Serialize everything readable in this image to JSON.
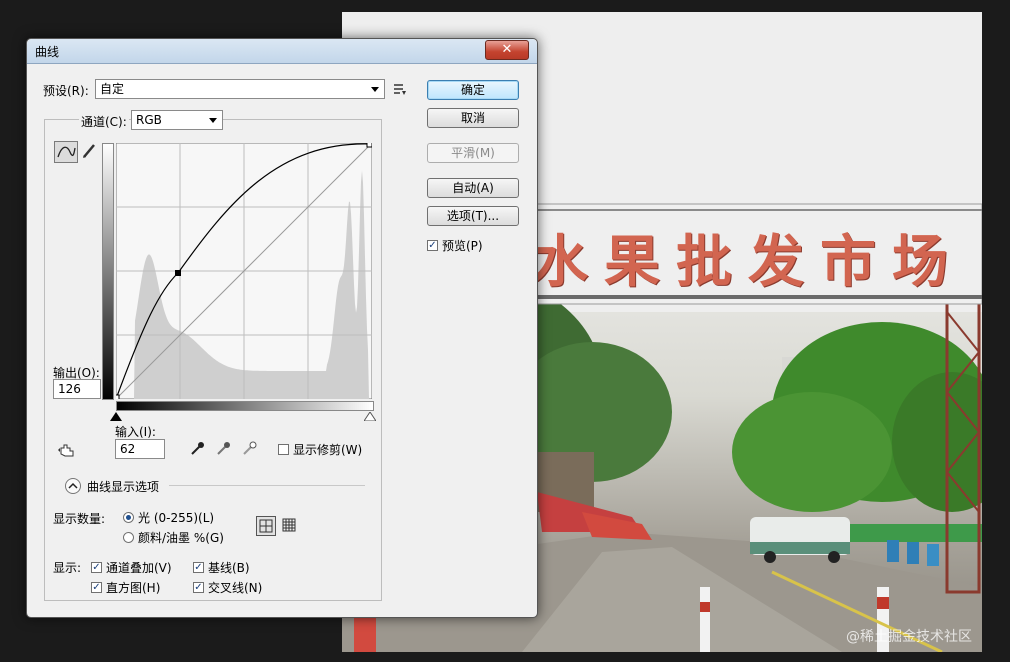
{
  "dialog": {
    "title": "曲线",
    "close_label": "✕",
    "preset_label": "预设(R):",
    "preset_value": "自定",
    "channel_label": "通道(C):",
    "channel_value": "RGB",
    "output_label": "输出(O):",
    "output_value": "126",
    "input_label": "输入(I):",
    "input_value": "62",
    "show_clipping_label": "显示修剪(W)",
    "curve_options_label": "曲线显示选项",
    "show_amount_label": "显示数量:",
    "light_label": "光 (0-255)(L)",
    "pigment_label": "颜料/油墨 %(G)",
    "show_label": "显示:",
    "channel_overlay_label": "通道叠加(V)",
    "baseline_label": "基线(B)",
    "histogram_label": "直方图(H)",
    "intersection_label": "交叉线(N)",
    "light_selected": true,
    "channel_overlay_checked": true,
    "baseline_checked": true,
    "histogram_checked": true,
    "intersection_checked": true,
    "show_clipping_checked": false
  },
  "buttons": {
    "ok": "确定",
    "cancel": "取消",
    "smooth": "平滑(M)",
    "auto": "自动(A)",
    "options": "选项(T)...",
    "preview_label": "预览(P)",
    "preview_checked": true
  },
  "curve": {
    "control_point": {
      "input": 62,
      "output": 126
    }
  },
  "photo": {
    "sign_text": "水果批发市场",
    "watermark": "@稀土掘金技术社区"
  },
  "icons": {
    "curve_tool": "curve-tool-icon",
    "pencil_tool": "pencil-icon",
    "hand_tool": "targeted-adjust-icon",
    "black_eyedropper": "black-point-eyedropper-icon",
    "gray_eyedropper": "gray-point-eyedropper-icon",
    "white_eyedropper": "white-point-eyedropper-icon",
    "preset_menu": "preset-menu-icon",
    "grid_simple": "grid-4x4-icon",
    "grid_detailed": "grid-10x10-icon"
  }
}
